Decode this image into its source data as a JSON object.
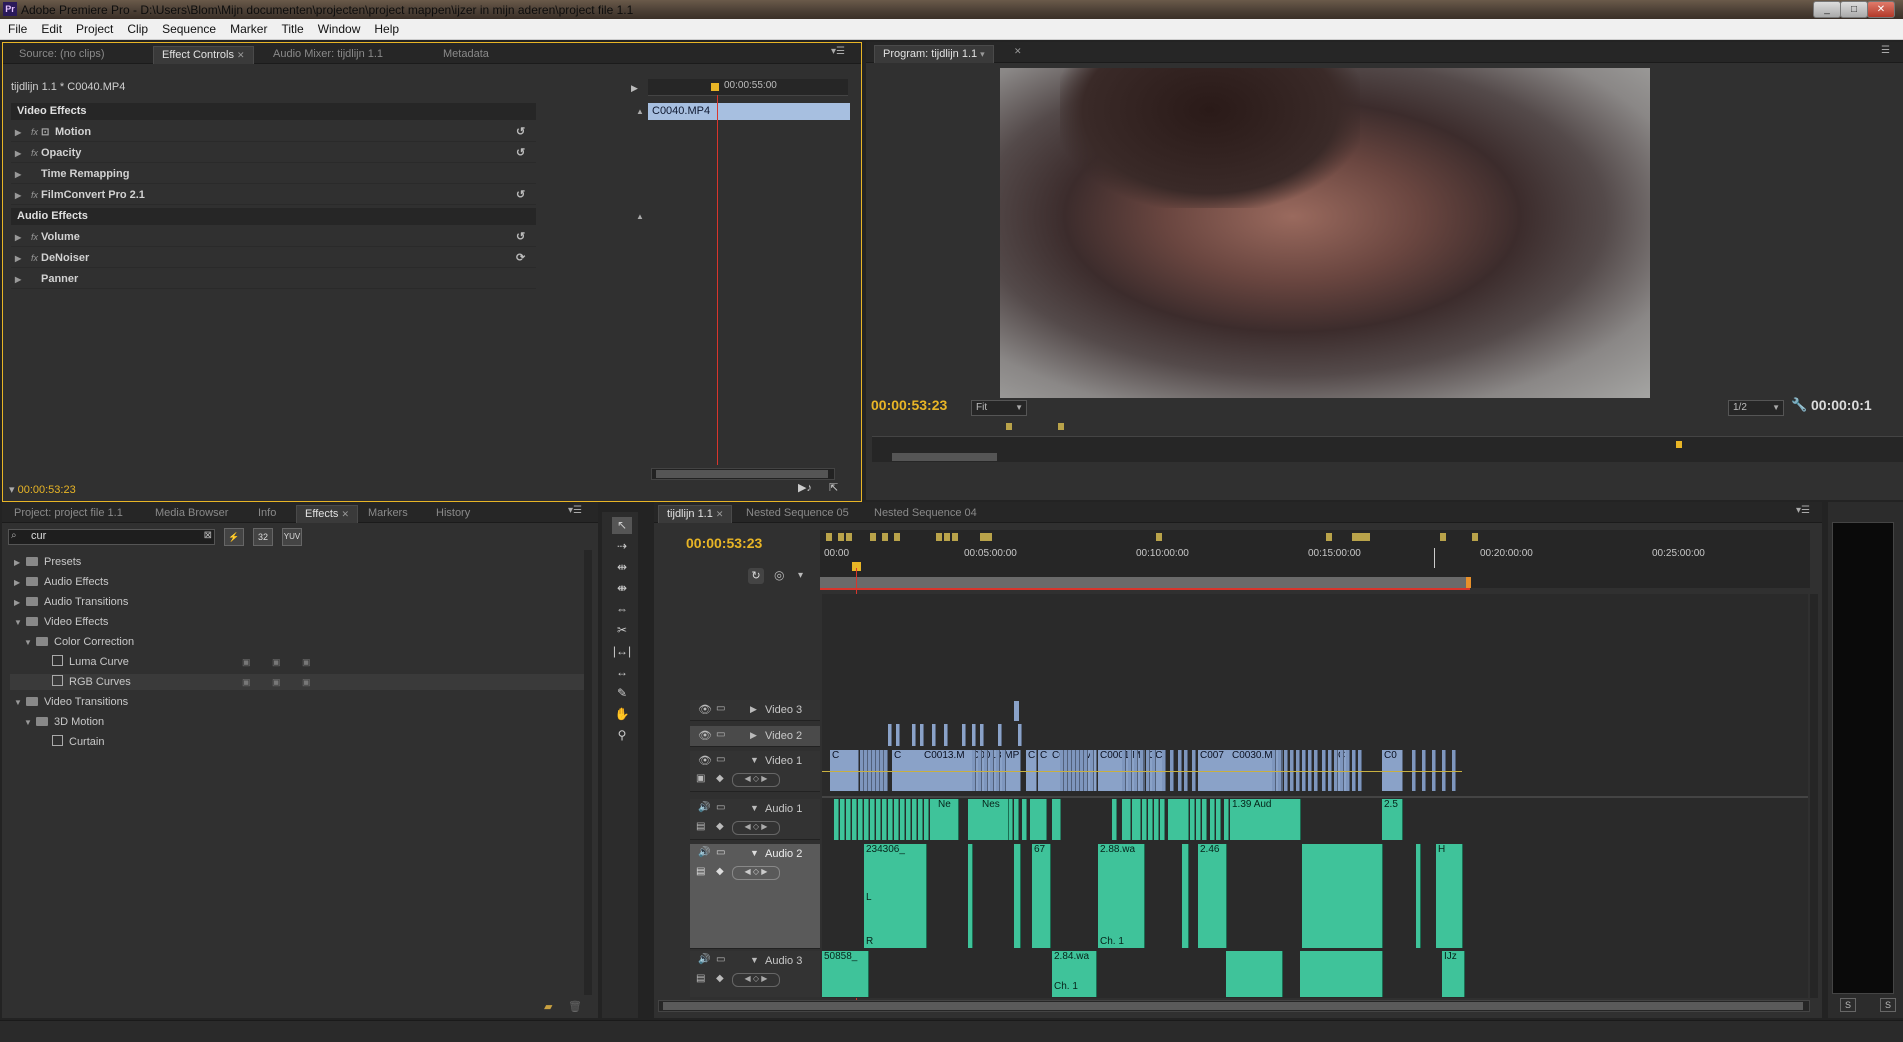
{
  "titlebar": {
    "title": "Adobe Premiere Pro - D:\\Users\\Blom\\Mijn documenten\\projecten\\project mappen\\ijzer in mijn aderen\\project file 1.1",
    "app_icon": "Pr"
  },
  "menu": [
    "File",
    "Edit",
    "Project",
    "Clip",
    "Sequence",
    "Marker",
    "Title",
    "Window",
    "Help"
  ],
  "source_panel": {
    "tabs": [
      "Source: (no clips)",
      "Effect Controls",
      "Audio Mixer: tijdlijn 1.1",
      "Metadata"
    ]
  },
  "effect_controls": {
    "clip_path": "tijdlijn 1.1 * C0040.MP4",
    "ruler_time": "00:00:55:00",
    "clip_name": "C0040.MP4",
    "video_header": "Video Effects",
    "video_effects": [
      {
        "name": "Motion",
        "fx": true,
        "reset": true
      },
      {
        "name": "Opacity",
        "fx": true,
        "reset": true
      },
      {
        "name": "Time Remapping",
        "fx": false,
        "reset": false
      },
      {
        "name": "FilmConvert Pro 2.1",
        "fx": true,
        "reset": true
      }
    ],
    "audio_header": "Audio Effects",
    "audio_effects": [
      {
        "name": "Volume",
        "fx": true,
        "reset": true
      },
      {
        "name": "DeNoiser",
        "fx": true,
        "reset": true
      },
      {
        "name": "Panner",
        "fx": false,
        "reset": false
      }
    ],
    "timecode": "00:00:53:23"
  },
  "program": {
    "tab": "Program: tijdlijn 1.1",
    "timecode": "00:00:53:23",
    "fit": "Fit",
    "resolution": "1/2",
    "duration": "00:00:0:1"
  },
  "project_panel": {
    "tabs": [
      "Project: project file 1.1",
      "Media Browser",
      "Info",
      "Effects",
      "Markers",
      "History"
    ],
    "search": "cur",
    "search_buttons": [
      "32",
      "YUV"
    ],
    "tree": [
      {
        "label": "Presets",
        "depth": 0,
        "open": false,
        "type": "folder"
      },
      {
        "label": "Audio Effects",
        "depth": 0,
        "open": false,
        "type": "folder"
      },
      {
        "label": "Audio Transitions",
        "depth": 0,
        "open": false,
        "type": "folder"
      },
      {
        "label": "Video Effects",
        "depth": 0,
        "open": true,
        "type": "folder"
      },
      {
        "label": "Color Correction",
        "depth": 1,
        "open": true,
        "type": "folder"
      },
      {
        "label": "Luma Curve",
        "depth": 2,
        "open": false,
        "type": "effect"
      },
      {
        "label": "RGB Curves",
        "depth": 2,
        "open": false,
        "type": "effect"
      },
      {
        "label": "Video Transitions",
        "depth": 0,
        "open": true,
        "type": "folder"
      },
      {
        "label": "3D Motion",
        "depth": 1,
        "open": true,
        "type": "folder"
      },
      {
        "label": "Curtain",
        "depth": 2,
        "open": false,
        "type": "transition"
      }
    ]
  },
  "timeline": {
    "tabs": [
      "tijdlijn 1.1",
      "Nested Sequence 05",
      "Nested Sequence 04"
    ],
    "timecode": "00:00:53:23",
    "ruler": [
      "00:00",
      "00:05:00:00",
      "00:10:00:00",
      "00:15:00:00",
      "00:20:00:00",
      "00:25:00:00"
    ],
    "tracks": {
      "video": [
        "Video 3",
        "Video 2",
        "Video 1"
      ],
      "audio": [
        "Audio 1",
        "Audio 2",
        "Audio 3"
      ]
    },
    "video1_clips": [
      "C",
      "C",
      "C0013.M",
      "C0013.MP",
      "C",
      "C",
      "C0106.M",
      "C0001.M",
      "CC",
      "C007",
      "C0030.M",
      "C",
      "C0"
    ],
    "audio1_clips": [
      "Ne",
      "Nes",
      "1.39 Aud",
      "2.5"
    ],
    "audio2_clips": [
      "234306_",
      "67",
      "2.88.wa",
      "2.46",
      "H"
    ],
    "audio2_labels": [
      "L",
      "R",
      "Ch. 1"
    ],
    "audio3_clips": [
      "50858_",
      "2.84.wa",
      "Ch. 1",
      "IJz"
    ]
  },
  "colors": {
    "accent": "#e8b526",
    "video_clip": "#8aa2c8",
    "audio_clip": "#3fc39a",
    "playhead": "#d8352c"
  }
}
